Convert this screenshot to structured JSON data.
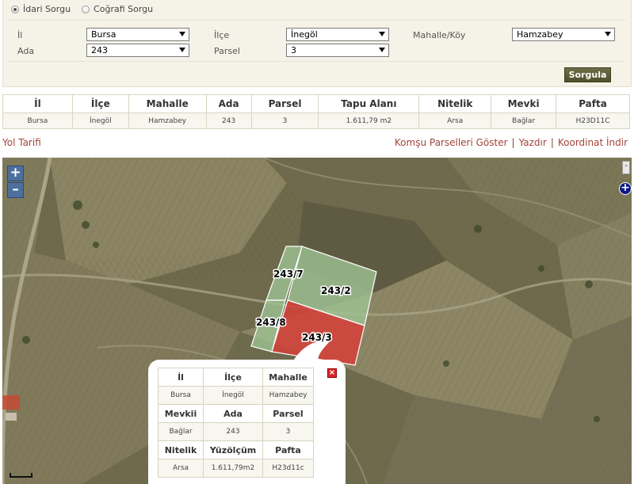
{
  "query": {
    "radio_admin": "İdari Sorgu",
    "radio_geo": "Coğrafi Sorgu",
    "label_il": "İl",
    "label_ilce": "İlçe",
    "label_mahalle": "Mahalle/Köy",
    "label_ada": "Ada",
    "label_parsel": "Parsel",
    "il_value": "Bursa",
    "ilce_value": "İnegöl",
    "mahalle_value": "Hamzabey",
    "ada_value": "243",
    "parsel_value": "3",
    "query_button": "Sorgula"
  },
  "results": {
    "headers": [
      "İl",
      "İlçe",
      "Mahalle",
      "Ada",
      "Parsel",
      "Tapu Alanı",
      "Nitelik",
      "Mevki",
      "Pafta"
    ],
    "row": [
      "Bursa",
      "İnegöl",
      "Hamzabey",
      "243",
      "3",
      "1.611,79 m2",
      "Arsa",
      "Bağlar",
      "H23D11C"
    ]
  },
  "links": {
    "directions": "Yol Tarifi",
    "neighbors": "Komşu Parselleri Göster",
    "print": "Yazdır",
    "coords": "Koordinat İndir",
    "separator": "|"
  },
  "map": {
    "zoom_in": "+",
    "zoom_out": "–",
    "collapse": "-",
    "layers": "+",
    "parcels": [
      "243/7",
      "243/2",
      "243/8",
      "243/3"
    ],
    "colors": {
      "selected": "#d6403a",
      "neighbor": "#9ec394",
      "outline": "#ffffff"
    }
  },
  "popup": {
    "close": "×",
    "rows": [
      {
        "headers": [
          "İl",
          "İlçe",
          "Mahalle"
        ],
        "values": [
          "Bursa",
          "İnegöl",
          "Hamzabey"
        ]
      },
      {
        "headers": [
          "Mevkii",
          "Ada",
          "Parsel"
        ],
        "values": [
          "Bağlar",
          "243",
          "3"
        ]
      },
      {
        "headers": [
          "Nitelik",
          "Yüzölçüm",
          "Pafta"
        ],
        "values": [
          "Arsa",
          "1.611,79m2",
          "H23d11c"
        ]
      }
    ]
  }
}
